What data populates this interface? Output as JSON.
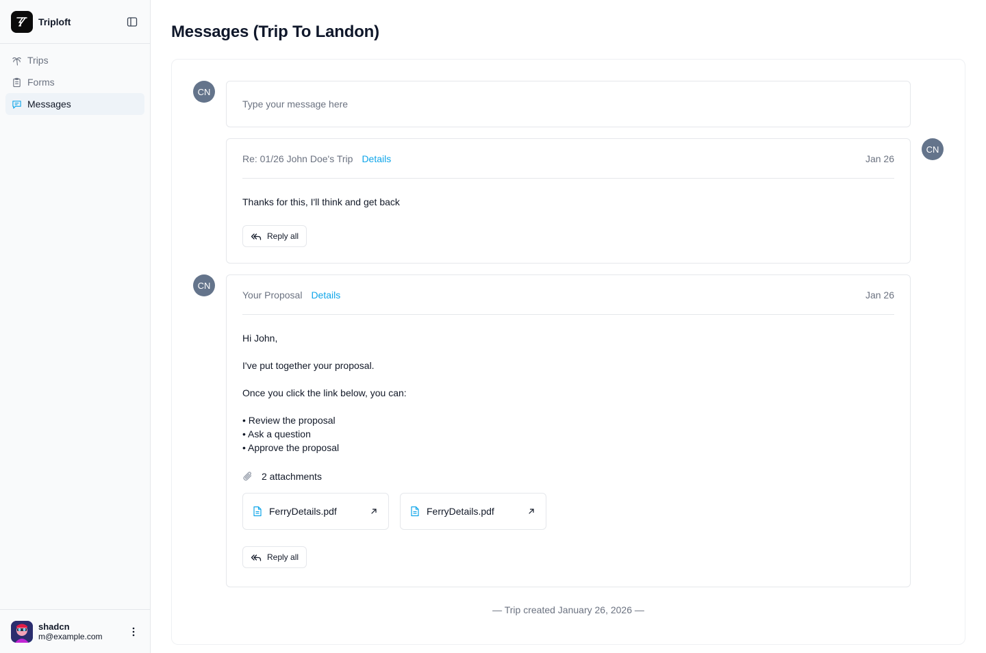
{
  "app": {
    "name": "Triploft"
  },
  "sidebar": {
    "items": [
      {
        "label": "Trips",
        "icon": "palm-tree-icon"
      },
      {
        "label": "Forms",
        "icon": "clipboard-icon"
      },
      {
        "label": "Messages",
        "icon": "message-icon",
        "active": true
      }
    ]
  },
  "user": {
    "name": "shadcn",
    "email": "m@example.com"
  },
  "page": {
    "title": "Messages (Trip To Landon)"
  },
  "composer": {
    "placeholder": "Type your message here",
    "avatar": "CN"
  },
  "messages": [
    {
      "avatar": "CN",
      "subject": "Re: 01/26 John Doe's Trip",
      "details_label": "Details",
      "date": "Jan 26",
      "body": "Thanks for this, I'll think and get back",
      "reply_label": "Reply all"
    },
    {
      "avatar": "CN",
      "subject": "Your Proposal",
      "details_label": "Details",
      "date": "Jan 26",
      "body_lines": [
        "Hi John,",
        "I've put together your proposal.",
        "Once you click the link below, you can:",
        "• Review the proposal",
        "• Ask a question",
        "• Approve the proposal"
      ],
      "attachments_label": "2 attachments",
      "attachments": [
        {
          "name": "FerryDetails.pdf"
        },
        {
          "name": "FerryDetails.pdf"
        }
      ],
      "reply_label": "Reply all"
    }
  ],
  "footer_note": "— Trip created January 26, 2026 —",
  "colors": {
    "accent": "#0ea5e9",
    "avatar_bg": "#64748b",
    "active_nav_bg": "#eef3f8"
  }
}
